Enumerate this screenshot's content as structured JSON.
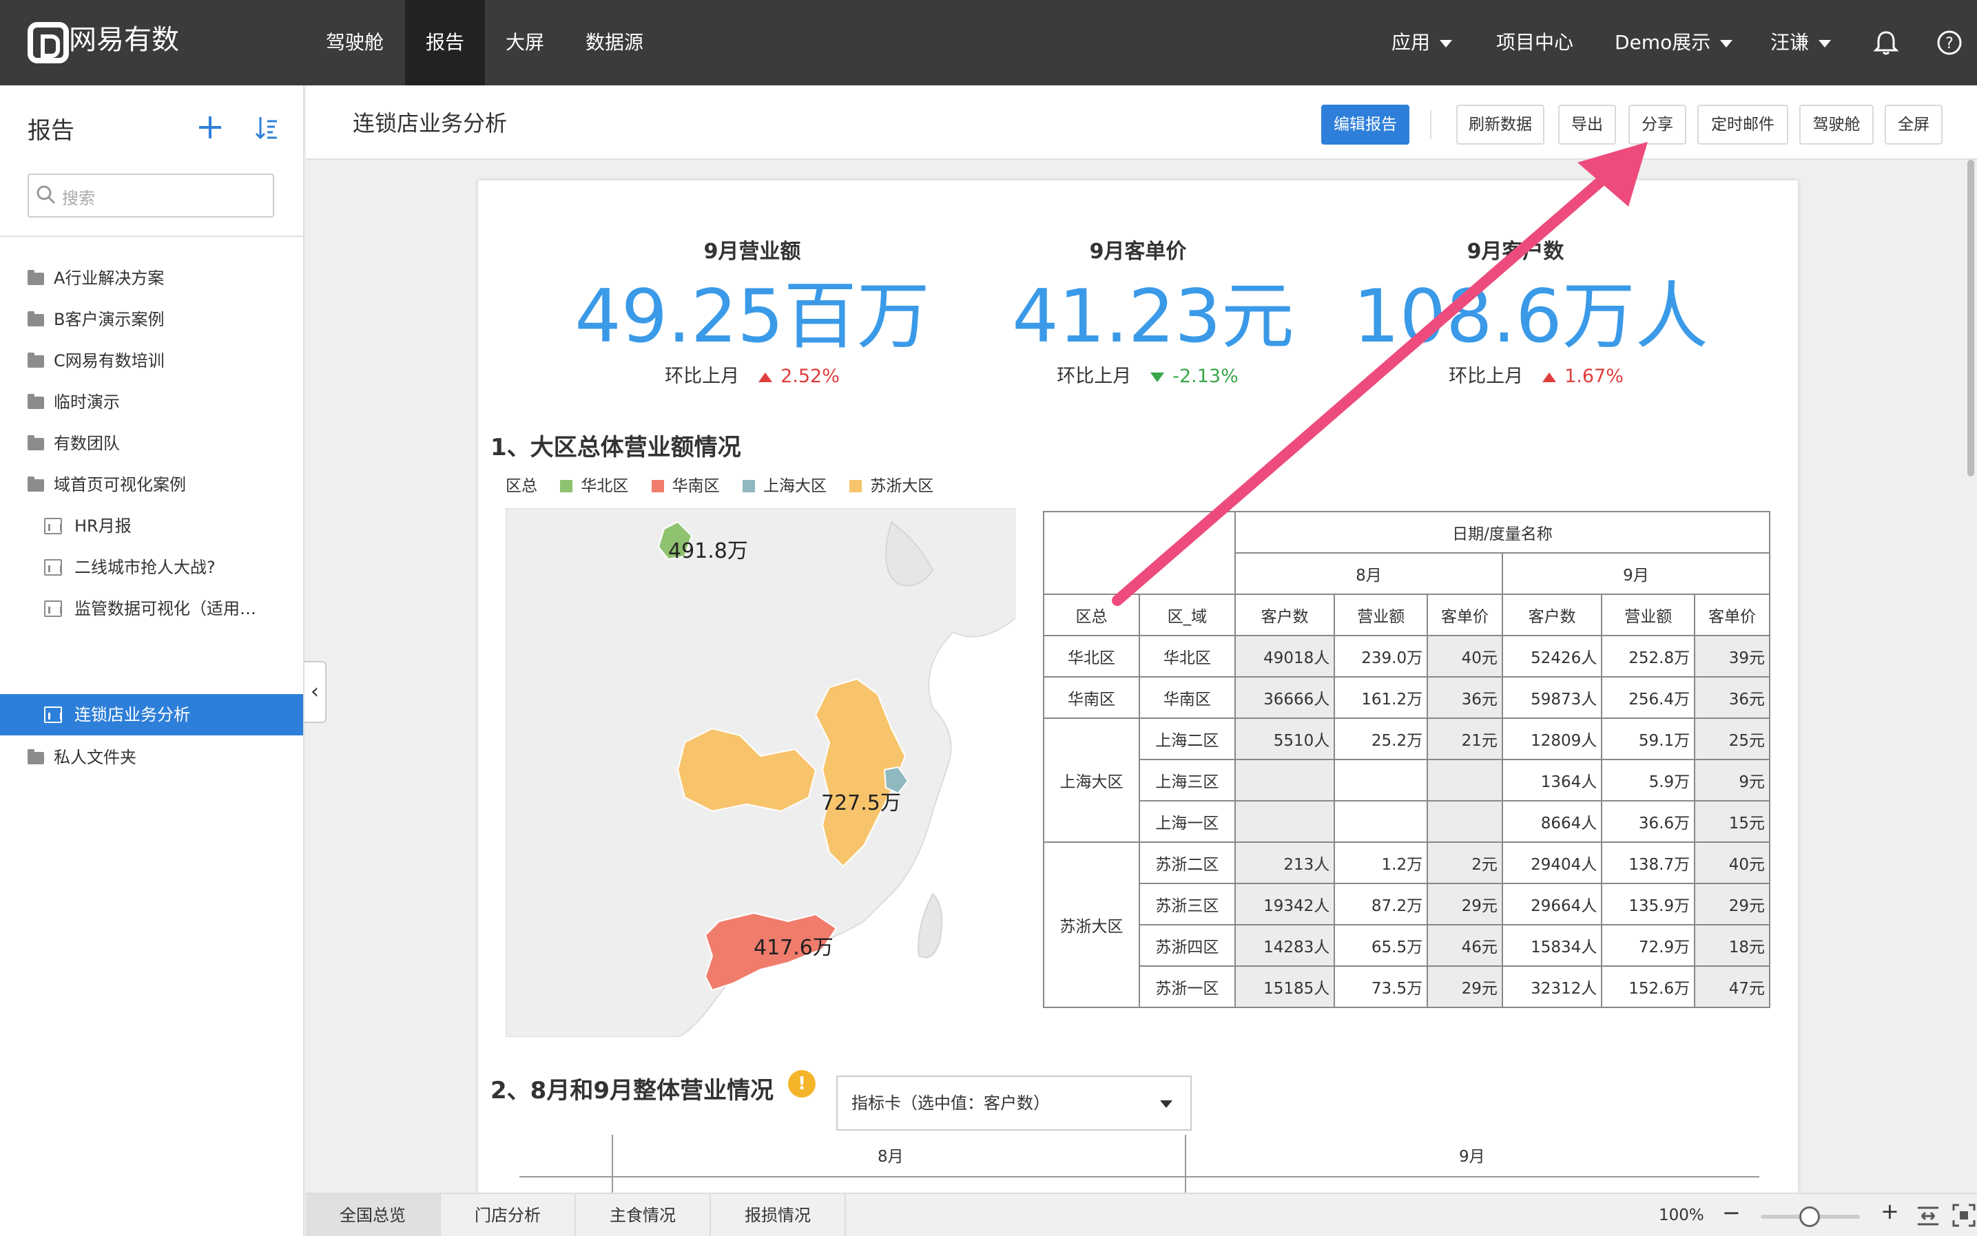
{
  "app": {
    "brand": "网易有数"
  },
  "topnav": {
    "items": [
      {
        "label": "驾驶舱"
      },
      {
        "label": "报告"
      },
      {
        "label": "大屏"
      },
      {
        "label": "数据源"
      }
    ],
    "right": {
      "apps": "应用",
      "project": "项目中心",
      "demo": "Demo展示",
      "user": "汪谦"
    }
  },
  "sidebar": {
    "title": "报告",
    "search_placeholder": "搜索",
    "items": [
      {
        "label": "A行业解决方案"
      },
      {
        "label": "B客户演示案例"
      },
      {
        "label": "C网易有数培训"
      },
      {
        "label": "临时演示"
      },
      {
        "label": "有数团队"
      },
      {
        "label": "域首页可视化案例"
      },
      {
        "label": "HR月报"
      },
      {
        "label": "二线城市抢人大战?"
      },
      {
        "label": "监管数据可视化（适用…"
      },
      {
        "label": "连锁店业务分析"
      },
      {
        "label": "私人文件夹"
      }
    ]
  },
  "toolbar": {
    "title": "连锁店业务分析",
    "edit": "编辑报告",
    "refresh": "刷新数据",
    "export": "导出",
    "share": "分享",
    "mail": "定时邮件",
    "cockpit": "驾驶舱",
    "fullscreen": "全屏"
  },
  "report": {
    "kpis": [
      {
        "title": "9月营业额",
        "value": "49.25百万",
        "compare_label": "环比上月",
        "change": "2.52%"
      },
      {
        "title": "9月客单价",
        "value": "41.23元",
        "compare_label": "环比上月",
        "change": "-2.13%"
      },
      {
        "title": "9月客户数",
        "value": "108.6万人",
        "compare_label": "环比上月",
        "change": "1.67%"
      }
    ],
    "section1": "1、大区总体营业额情况",
    "legend": {
      "prefix": "区总",
      "items": [
        {
          "label": "华北区",
          "color": "#8fc26f"
        },
        {
          "label": "华南区",
          "color": "#f07c6c"
        },
        {
          "label": "上海大区",
          "color": "#8fb8bf"
        },
        {
          "label": "苏浙大区",
          "color": "#f7c46c"
        }
      ]
    },
    "map_labels": {
      "north": "491.8万",
      "east": "727.5万",
      "south": "417.6万"
    },
    "table": {
      "top_header": "日期/度量名称",
      "months": [
        "8月",
        "9月"
      ],
      "columns": [
        "区总",
        "区_域",
        "客户数",
        "营业额",
        "客单价",
        "客户数",
        "营业额",
        "客单价"
      ],
      "groups": [
        {
          "region": "华北区",
          "rows": [
            [
              "华北区",
              "49018人",
              "239.0万",
              "40元",
              "52426人",
              "252.8万",
              "39元"
            ]
          ]
        },
        {
          "region": "华南区",
          "rows": [
            [
              "华南区",
              "36666人",
              "161.2万",
              "36元",
              "59873人",
              "256.4万",
              "36元"
            ]
          ]
        },
        {
          "region": "上海大区",
          "rows": [
            [
              "上海二区",
              "5510人",
              "25.2万",
              "21元",
              "12809人",
              "59.1万",
              "25元"
            ],
            [
              "上海三区",
              "",
              "",
              "",
              "1364人",
              "5.9万",
              "9元"
            ],
            [
              "上海一区",
              "",
              "",
              "",
              "8664人",
              "36.6万",
              "15元"
            ]
          ]
        },
        {
          "region": "苏浙大区",
          "rows": [
            [
              "苏浙二区",
              "213人",
              "1.2万",
              "2元",
              "29404人",
              "138.7万",
              "40元"
            ],
            [
              "苏浙三区",
              "19342人",
              "87.2万",
              "29元",
              "29664人",
              "135.9万",
              "29元"
            ],
            [
              "苏浙四区",
              "14283人",
              "65.5万",
              "46元",
              "15834人",
              "72.9万",
              "18元"
            ],
            [
              "苏浙一区",
              "15185人",
              "73.5万",
              "29元",
              "32312人",
              "152.6万",
              "47元"
            ]
          ]
        }
      ]
    },
    "section2": "2、8月和9月整体营业情况",
    "dropdown": "指标卡（选中值：客户数）",
    "sub_months": [
      "8月",
      "9月"
    ]
  },
  "bottom": {
    "tabs": [
      "全国总览",
      "门店分析",
      "主食情况",
      "报损情况"
    ],
    "zoom": "100%"
  },
  "annotation": {
    "arrow_color": "#ee4b7d"
  }
}
